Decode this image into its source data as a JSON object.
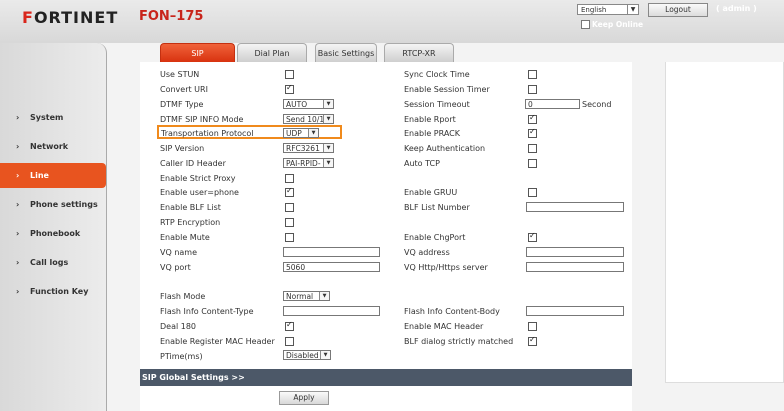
{
  "header": {
    "logo_prefix": "F",
    "logo_rest": "ORTINET",
    "model": "FON–175",
    "language": "English",
    "logout_label": "Logout",
    "user": "( admin )",
    "keep_online_label": "Keep Online"
  },
  "tabs": [
    {
      "label": "SIP",
      "active": true
    },
    {
      "label": "Dial Plan",
      "active": false
    },
    {
      "label": "Basic Settings",
      "active": false
    },
    {
      "label": "RTCP-XR",
      "active": false
    }
  ],
  "sidebar": [
    {
      "label": "System",
      "active": false
    },
    {
      "label": "Network",
      "active": false
    },
    {
      "label": "Line",
      "active": true
    },
    {
      "label": "Phone settings",
      "active": false
    },
    {
      "label": "Phonebook",
      "active": false
    },
    {
      "label": "Call logs",
      "active": false
    },
    {
      "label": "Function Key",
      "active": false
    }
  ],
  "form": {
    "left": {
      "use_stun": {
        "label": "Use STUN",
        "checked": false
      },
      "convert_uri": {
        "label": "Convert URI",
        "checked": true
      },
      "dtmf_type": {
        "label": "DTMF Type",
        "value": "AUTO"
      },
      "dtmf_sip_info_mode": {
        "label": "DTMF SIP INFO Mode",
        "value": "Send 10/1"
      },
      "transportation_protocol": {
        "label": "Transportation Protocol",
        "value": "UDP"
      },
      "sip_version": {
        "label": "SIP Version",
        "value": "RFC3261"
      },
      "caller_id_header": {
        "label": "Caller ID Header",
        "value": "PAI-RPID-"
      },
      "enable_strict_proxy": {
        "label": "Enable Strict Proxy",
        "checked": false
      },
      "enable_user_phone": {
        "label": "Enable user=phone",
        "checked": true
      },
      "enable_blf_list": {
        "label": "Enable BLF List",
        "checked": false
      },
      "rtp_encryption": {
        "label": "RTP Encryption",
        "checked": false
      },
      "enable_mute": {
        "label": "Enable Mute",
        "checked": false
      },
      "vq_name": {
        "label": "VQ name",
        "value": ""
      },
      "vq_port": {
        "label": "VQ port",
        "value": "5060"
      },
      "flash_mode": {
        "label": "Flash Mode",
        "value": "Normal"
      },
      "flash_info_content_type": {
        "label": "Flash Info Content-Type",
        "value": ""
      },
      "deal_180": {
        "label": "Deal 180",
        "checked": true
      },
      "enable_register_mac_header": {
        "label": "Enable Register MAC Header",
        "checked": false
      },
      "ptime": {
        "label": "PTime(ms)",
        "value": "Disabled"
      }
    },
    "right": {
      "sync_clock_time": {
        "label": "Sync Clock Time",
        "checked": false
      },
      "enable_session_timer": {
        "label": "Enable Session Timer",
        "checked": false
      },
      "session_timeout": {
        "label": "Session Timeout",
        "value": "0",
        "unit": "Second"
      },
      "enable_rport": {
        "label": "Enable Rport",
        "checked": true
      },
      "enable_prack": {
        "label": "Enable PRACK",
        "checked": true
      },
      "keep_authentication": {
        "label": "Keep Authentication",
        "checked": false
      },
      "auto_tcp": {
        "label": "Auto TCP",
        "checked": false
      },
      "enable_gruu": {
        "label": "Enable GRUU",
        "checked": false
      },
      "blf_list_number": {
        "label": "BLF List Number",
        "value": ""
      },
      "enable_chgport": {
        "label": "Enable ChgPort",
        "checked": true
      },
      "vq_address": {
        "label": "VQ address",
        "value": ""
      },
      "vq_http_server": {
        "label": "VQ Http/Https server",
        "value": ""
      },
      "flash_info_content_body": {
        "label": "Flash Info Content-Body",
        "value": ""
      },
      "enable_mac_header": {
        "label": "Enable MAC Header",
        "checked": false
      },
      "blf_dialog_strictly_matched": {
        "label": "BLF dialog strictly matched",
        "checked": true
      }
    }
  },
  "sip_global_label": "SIP Global Settings >>",
  "apply_label": "Apply"
}
